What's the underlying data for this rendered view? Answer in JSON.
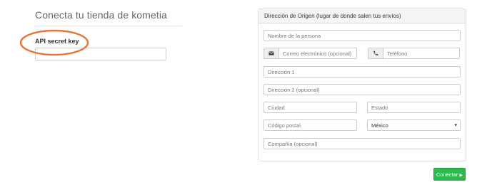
{
  "left": {
    "title": "Conecta tu tienda de kometia",
    "api_label": "API secret key",
    "api_value": ""
  },
  "panel": {
    "heading": "Dirección de Origen (lugar de donde salen tus envíos)",
    "fields": {
      "name": "Nombre de la persona",
      "email": "Correo electrónico (opcional)",
      "phone": "Teléfono",
      "address1": "Dirección 1",
      "address2": "Dirección 2 (opcional)",
      "city": "Ciudad",
      "state": "Estado",
      "postal": "Código postal",
      "country": "México",
      "company": "Compañía (opcional)"
    }
  },
  "actions": {
    "connect_label": "Conectar",
    "connect_icon": "caret-right-icon"
  },
  "icons": {
    "email": "envelope-icon",
    "phone": "phone-icon",
    "country_select": "chevron-down-icon"
  },
  "colors": {
    "primary_button": "#2eb84d",
    "annotation_ellipse": "#e8763a"
  }
}
